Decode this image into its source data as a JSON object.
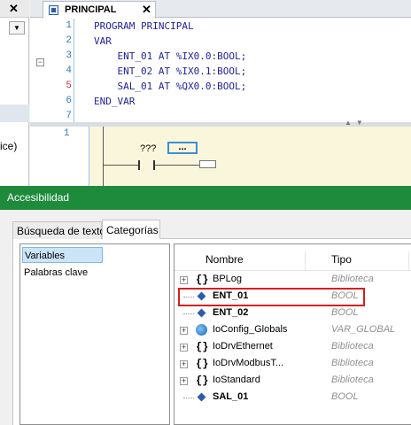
{
  "left_pane": {
    "close_glyph": "✕",
    "partial_label": "ice)"
  },
  "editor": {
    "tab_label": "PRINCIPAL",
    "tab_close": "✕",
    "code_lines": [
      {
        "ln": "1",
        "text": "PROGRAM PRINCIPAL"
      },
      {
        "ln": "2",
        "text": "VAR"
      },
      {
        "ln": "3",
        "text": "    ENT_01 AT %IX0.0:BOOL;"
      },
      {
        "ln": "4",
        "text": "    ENT_02 AT %IX0.1:BOOL;"
      },
      {
        "ln": "5",
        "text": "    SAL_01 AT %QX0.0:BOOL;"
      },
      {
        "ln": "6",
        "text": "END_VAR"
      },
      {
        "ln": "7",
        "text": ""
      }
    ],
    "ladder": {
      "network_number": "1",
      "contact_label": "???",
      "coil_label": "..."
    }
  },
  "accessibility": {
    "title": "Accesibilidad",
    "tabs": [
      "Búsqueda de texto",
      "Categorías"
    ],
    "active_tab": "Categorías",
    "categories": [
      "Variables",
      "Palabras clave"
    ],
    "selected_category": "Variables",
    "columns": {
      "name": "Nombre",
      "type": "Tipo"
    },
    "rows": [
      {
        "name": "BPLog",
        "type": "Biblioteca",
        "icon": "library-braces-icon",
        "expandable": true,
        "bold": false
      },
      {
        "name": "ENT_01",
        "type": "BOOL",
        "icon": "variable-diamond-icon",
        "expandable": false,
        "bold": true,
        "highlighted": true
      },
      {
        "name": "ENT_02",
        "type": "BOOL",
        "icon": "variable-diamond-icon",
        "expandable": false,
        "bold": true
      },
      {
        "name": "IoConfig_Globals",
        "type": "VAR_GLOBAL",
        "icon": "globe-icon",
        "expandable": true,
        "bold": false
      },
      {
        "name": "IoDrvEthernet",
        "type": "Biblioteca",
        "icon": "library-braces-icon",
        "expandable": true,
        "bold": false
      },
      {
        "name": "IoDrvModbusT...",
        "type": "Biblioteca",
        "icon": "library-braces-icon",
        "expandable": true,
        "bold": false
      },
      {
        "name": "IoStandard",
        "type": "Biblioteca",
        "icon": "library-braces-icon",
        "expandable": true,
        "bold": false
      },
      {
        "name": "SAL_01",
        "type": "BOOL",
        "icon": "variable-diamond-icon",
        "expandable": false,
        "bold": true
      }
    ]
  },
  "colors": {
    "title_bar": "#1e8a3c",
    "highlight": "#d52020",
    "line_numbers": "#2b7bc0"
  }
}
